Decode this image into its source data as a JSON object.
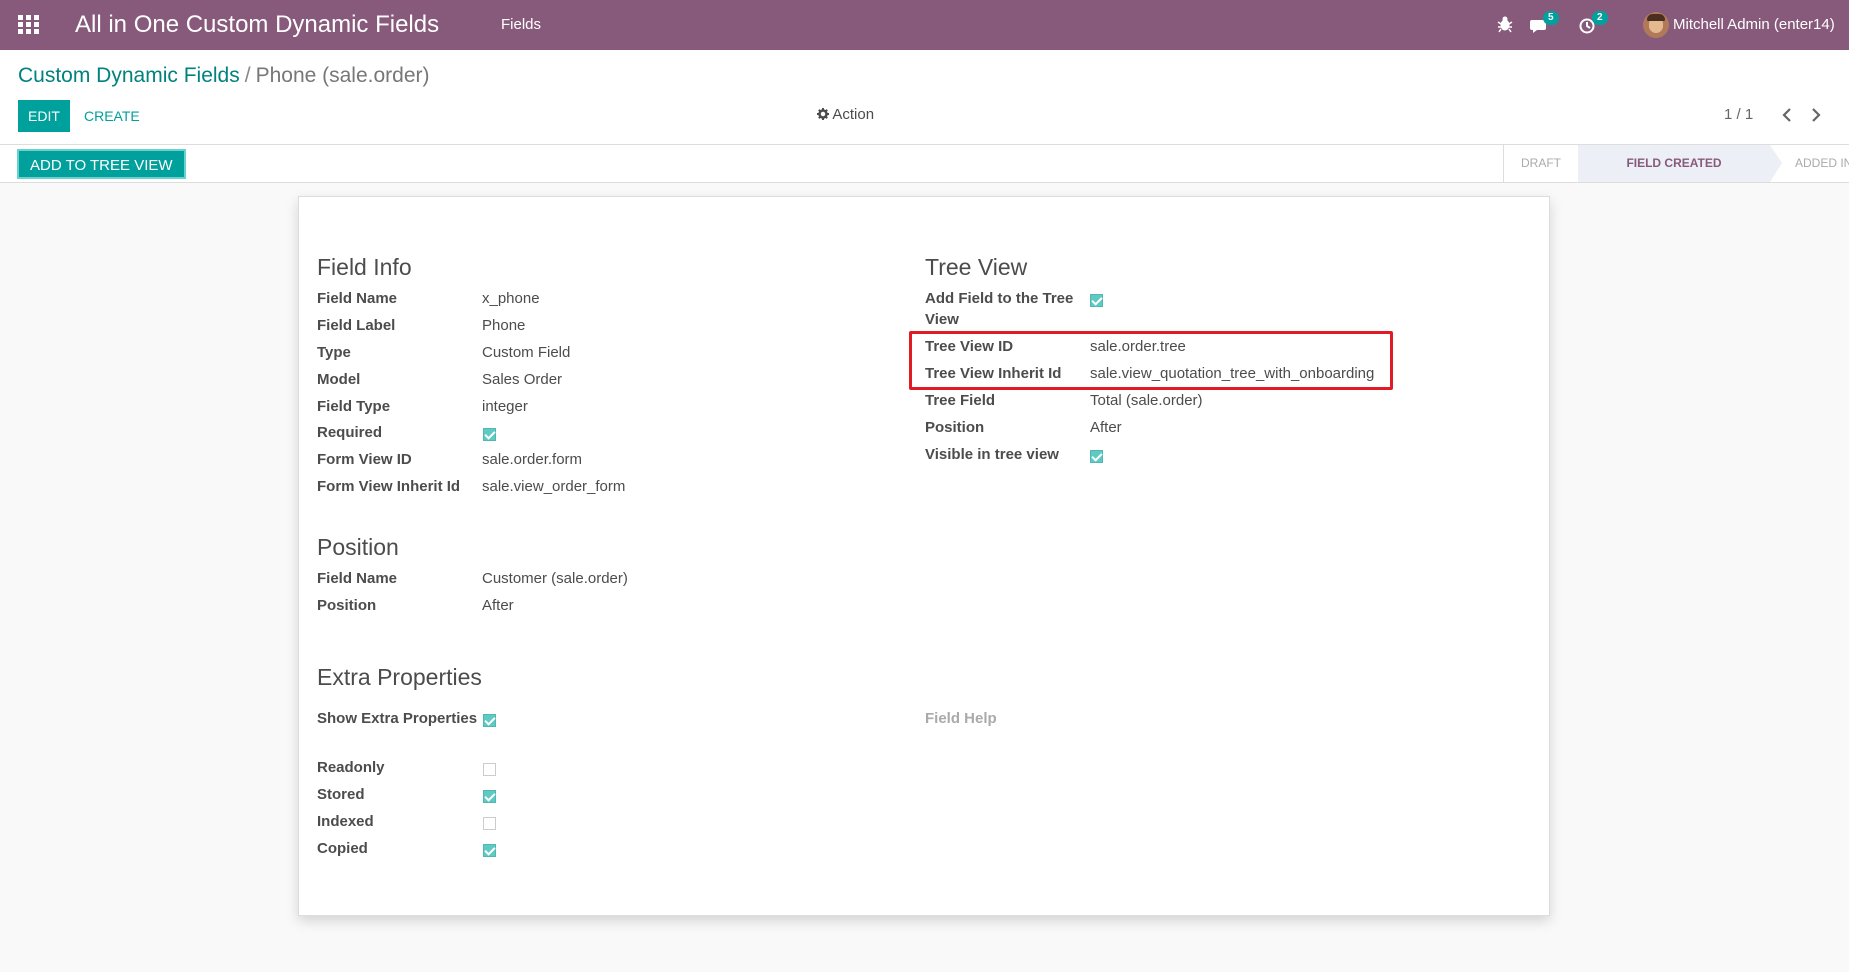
{
  "navbar": {
    "app_title": "All in One Custom Dynamic Fields",
    "menu_fields": "Fields",
    "messages_count": "5",
    "activities_count": "2",
    "user_name": "Mitchell Admin (enter14)"
  },
  "control_panel": {
    "breadcrumb_parent": "Custom Dynamic Fields",
    "breadcrumb_separator": "/",
    "breadcrumb_current": "Phone (sale.order)",
    "edit_label": "EDIT",
    "create_label": "CREATE",
    "action_label": "Action",
    "pager": "1 / 1"
  },
  "statusbar": {
    "add_tree_label": "ADD TO TREE VIEW",
    "stages": [
      "DRAFT",
      "FIELD CREATED",
      "ADDED IN TREE VIEW"
    ],
    "active_stage": "FIELD CREATED"
  },
  "field_info": {
    "title": "Field Info",
    "field_name_label": "Field Name",
    "field_name": "x_phone",
    "field_label_label": "Field Label",
    "field_label": "Phone",
    "type_label": "Type",
    "type": "Custom Field",
    "model_label": "Model",
    "model": "Sales Order",
    "field_type_label": "Field Type",
    "field_type": "integer",
    "required_label": "Required",
    "required": true,
    "form_view_id_label": "Form View ID",
    "form_view_id": "sale.order.form",
    "form_view_inherit_label": "Form View Inherit Id",
    "form_view_inherit": "sale.view_order_form"
  },
  "position": {
    "title": "Position",
    "field_name_label": "Field Name",
    "field_name": "Customer (sale.order)",
    "position_label": "Position",
    "position": "After"
  },
  "extra": {
    "title": "Extra Properties",
    "show_extra_label": "Show Extra Properties",
    "show_extra": true,
    "field_help_label": "Field Help",
    "readonly_label": "Readonly",
    "readonly": false,
    "stored_label": "Stored",
    "stored": true,
    "indexed_label": "Indexed",
    "indexed": false,
    "copied_label": "Copied",
    "copied": true
  },
  "tree_view": {
    "title": "Tree View",
    "add_field_label_line1": "Add Field to the Tree",
    "add_field_label_line2": "View",
    "add_field": true,
    "tree_view_id_label": "Tree View ID",
    "tree_view_id": "sale.order.tree",
    "tree_view_inherit_label": "Tree View Inherit Id",
    "tree_view_inherit": "sale.view_quotation_tree_with_onboarding",
    "tree_field_label": "Tree Field",
    "tree_field": "Total (sale.order)",
    "position_label": "Position",
    "position": "After",
    "visible_label": "Visible in tree view",
    "visible": true
  },
  "colors": {
    "navbar": "#875a7b",
    "primary": "#00a09d",
    "highlight": "#e01b24"
  }
}
